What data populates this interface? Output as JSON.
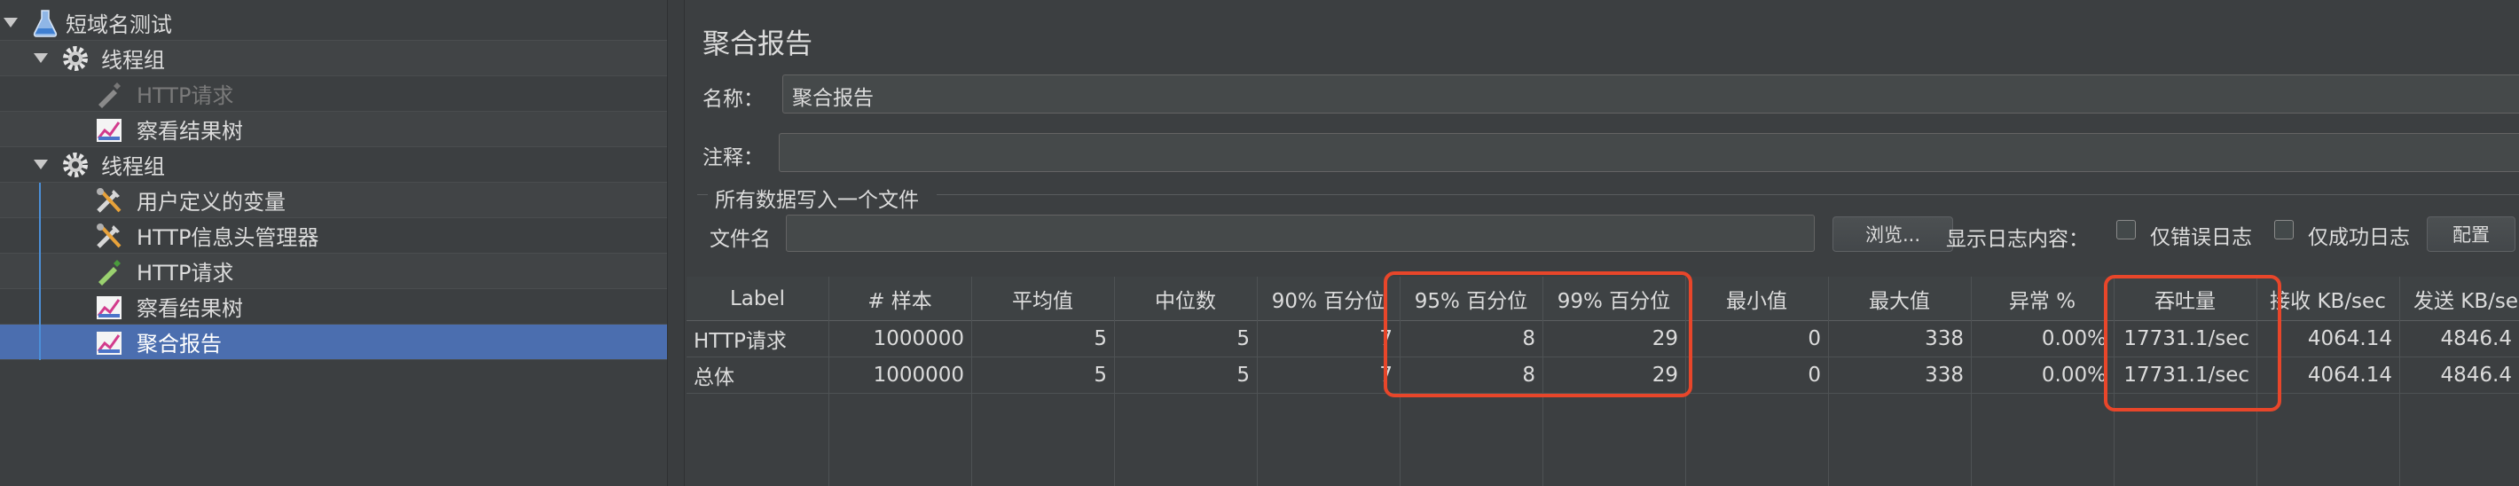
{
  "tree": {
    "items": [
      {
        "label": "短域名测试",
        "icon": "flask-icon"
      },
      {
        "label": "线程组",
        "icon": "gear-icon"
      },
      {
        "label": "HTTP请求",
        "icon": "pipette-icon"
      },
      {
        "label": "察看结果树",
        "icon": "chart-icon"
      },
      {
        "label": "线程组",
        "icon": "gear-icon"
      },
      {
        "label": "用户定义的变量",
        "icon": "tools-icon"
      },
      {
        "label": "HTTP信息头管理器",
        "icon": "tools-icon"
      },
      {
        "label": "HTTP请求",
        "icon": "pipette-icon"
      },
      {
        "label": "察看结果树",
        "icon": "chart-icon"
      },
      {
        "label": "聚合报告",
        "icon": "chart-icon"
      }
    ]
  },
  "panel": {
    "title": "聚合报告",
    "name_label": "名称：",
    "name_value": "聚合报告",
    "comment_label": "注释：",
    "comment_value": "",
    "group_title": "所有数据写入一个文件",
    "filename_label": "文件名",
    "filename_value": "",
    "browse_button": "浏览...",
    "log_label": "显示日志内容：",
    "errors_only": "仅错误日志",
    "success_only": "仅成功日志",
    "config_button": "配置"
  },
  "table": {
    "headers": [
      "Label",
      "# 样本",
      "平均值",
      "中位数",
      "90% 百分位",
      "95% 百分位",
      "99% 百分位",
      "最小值",
      "最大值",
      "异常 %",
      "吞吐量",
      "接收 KB/sec",
      "发送 KB/sec"
    ],
    "rows": [
      [
        "HTTP请求",
        "1000000",
        "5",
        "5",
        "7",
        "8",
        "29",
        "0",
        "338",
        "0.00%",
        "17731.1/sec",
        "4064.14",
        "4846.4"
      ],
      [
        "总体",
        "1000000",
        "5",
        "5",
        "7",
        "8",
        "29",
        "0",
        "338",
        "0.00%",
        "17731.1/sec",
        "4064.14",
        "4846.4"
      ]
    ]
  },
  "colors": {
    "background": "#3c3f41",
    "selection": "#4b6eaf",
    "highlight": "#e8462a",
    "text": "#dcdcdc"
  }
}
